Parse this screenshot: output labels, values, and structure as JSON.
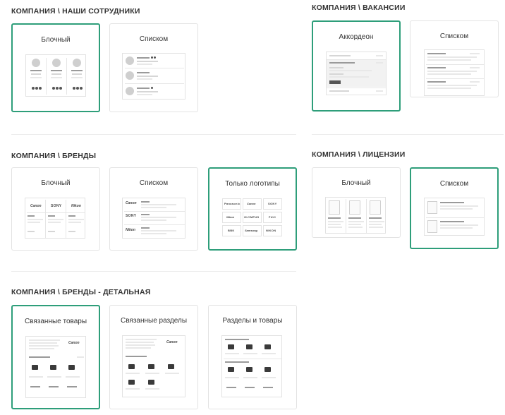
{
  "sections": {
    "staff": {
      "title": "КОМПАНИЯ \\ НАШИ СОТРУДНИКИ",
      "options": [
        {
          "label": "Блочный",
          "selected": true
        },
        {
          "label": "Списком",
          "selected": false
        }
      ]
    },
    "vacancies": {
      "title": "КОМПАНИЯ \\ ВАКАНСИИ",
      "options": [
        {
          "label": "Аккордеон",
          "selected": true
        },
        {
          "label": "Списком",
          "selected": false
        }
      ]
    },
    "brands": {
      "title": "КОМПАНИЯ \\ БРЕНДЫ",
      "options": [
        {
          "label": "Блочный",
          "selected": false
        },
        {
          "label": "Списком",
          "selected": false
        },
        {
          "label": "Только логотипы",
          "selected": true
        }
      ]
    },
    "licenses": {
      "title": "КОМПАНИЯ \\ ЛИЦЕНЗИИ",
      "options": [
        {
          "label": "Блочный",
          "selected": false
        },
        {
          "label": "Списком",
          "selected": true
        }
      ]
    },
    "brand_detail": {
      "title": "КОМПАНИЯ \\ БРЕНДЫ - ДЕТАЛЬНАЯ",
      "options": [
        {
          "label": "Связанные товары",
          "selected": true
        },
        {
          "label": "Связанные разделы",
          "selected": false
        },
        {
          "label": "Разделы и товары",
          "selected": false
        }
      ]
    }
  },
  "thumbnails": {
    "brand_logos": [
      "Canon",
      "SONY",
      "Nikon"
    ],
    "logo_grid": [
      "Panasonic",
      "Canon",
      "SONY",
      "Nikon",
      "OLYMPUS",
      "FUJI",
      "BBK",
      "Samsung",
      "NIKON"
    ],
    "detail_logo": "Canon"
  },
  "colors": {
    "selected_border": "#2e9e7a",
    "card_border": "#e3e3e3",
    "divider": "#ececec"
  }
}
